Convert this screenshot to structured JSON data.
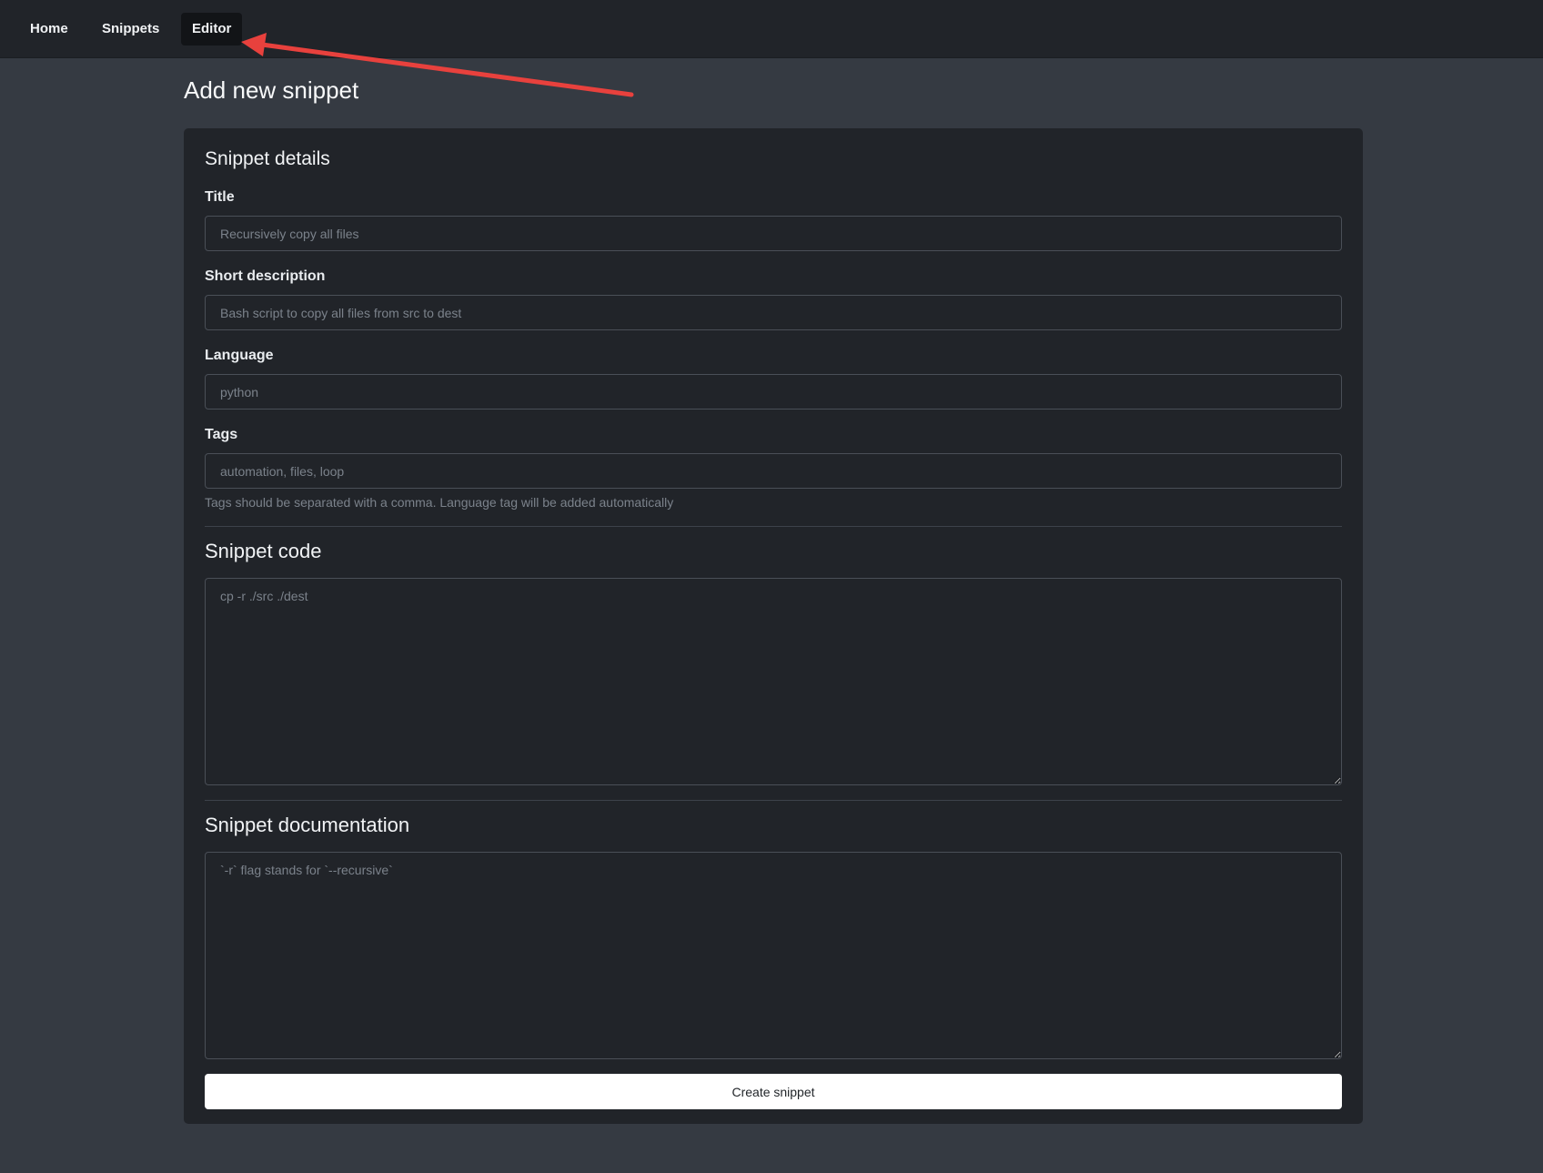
{
  "navbar": {
    "items": [
      {
        "label": "Home"
      },
      {
        "label": "Snippets"
      },
      {
        "label": "Editor",
        "active": true
      }
    ]
  },
  "page": {
    "title": "Add new snippet"
  },
  "form": {
    "details_heading": "Snippet details",
    "title_field": {
      "label": "Title",
      "value": "",
      "placeholder": "Recursively copy all files"
    },
    "description_field": {
      "label": "Short description",
      "value": "",
      "placeholder": "Bash script to copy all files from src to dest"
    },
    "language_field": {
      "label": "Language",
      "value": "",
      "placeholder": "python"
    },
    "tags_field": {
      "label": "Tags",
      "value": "",
      "placeholder": "automation, files, loop",
      "help": "Tags should be separated with a comma. Language tag will be added automatically"
    },
    "code_heading": "Snippet code",
    "code_field": {
      "value": "",
      "placeholder": "cp -r ./src ./dest"
    },
    "docs_heading": "Snippet documentation",
    "docs_field": {
      "value": "",
      "placeholder": "`-r` flag stands for `--recursive`"
    },
    "submit_label": "Create snippet"
  },
  "colors": {
    "page_bg": "#353a42",
    "navbar_bg": "#212429",
    "card_bg": "#212429",
    "annotation_arrow": "#e8413d",
    "button_bg": "#ffffff"
  }
}
